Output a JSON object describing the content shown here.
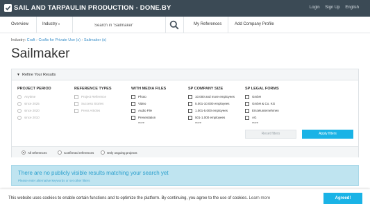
{
  "header": {
    "brand": "SAIL AND TARPAULIN PRODUCTION - DONE.BY",
    "links": [
      "Login",
      "Sign Up",
      "English"
    ]
  },
  "nav": {
    "overview": "Overview",
    "industry": "Industry",
    "search_value": "Search in 'Sailmaker'",
    "my_references": "My References",
    "add_profile": "Add Company Profile"
  },
  "breadcrumb": {
    "prefix": "Industry:",
    "items": [
      "Craft",
      "Crafts for Private Use (s)",
      "Sailmaker (s)"
    ]
  },
  "page_title": "Sailmaker",
  "filters": {
    "toggle": "▼",
    "title": "Refine Your Results",
    "project_period": {
      "title": "PROJECT PERIOD",
      "options": [
        "Anytime",
        "since 2025",
        "since 2020",
        "since 2010"
      ]
    },
    "reference_types": {
      "title": "REFERENCE TYPES",
      "options": [
        "Project Reference",
        "Success Stories",
        "Press Articles"
      ]
    },
    "media_files": {
      "title": "WITH MEDIA FILES",
      "options": [
        "Photo",
        "Video",
        "Audio File",
        "Presentation"
      ],
      "more": "more"
    },
    "company_size": {
      "title": "SP COMPANY SIZE",
      "options": [
        "10.000 and more employees",
        "5.001-10.000 employees",
        "1.001-5.000 employees",
        "501-1.000 employees"
      ],
      "more": "more"
    },
    "legal_forms": {
      "title": "SP LEGAL FORMS",
      "options": [
        "GmbH",
        "GmbH & Co. KG",
        "Einzelunternehmen",
        "AG"
      ],
      "more": "more"
    },
    "reset_label": "Reset filters",
    "apply_label": "Apply filters",
    "scope": {
      "all": "All references",
      "confirmed": "Confirmed references",
      "ongoing": "Only ongoing projects",
      "selected": "all"
    }
  },
  "notice": {
    "title": "There are no publicly visible results matching your search yet",
    "subtitle": "Please enter alternative keywords or set other filters"
  },
  "cookie": {
    "text": "This website uses cookies to enable certain functions and to optimize the platform. By continuing, you agree to the use of cookies.",
    "link": "Learn more",
    "button": "Agreed!"
  },
  "colors": {
    "topbar": "#3b4a55",
    "accent": "#1ab3e6",
    "notice_bg": "#bfe4f0",
    "notice_text": "#2a9fcd"
  }
}
